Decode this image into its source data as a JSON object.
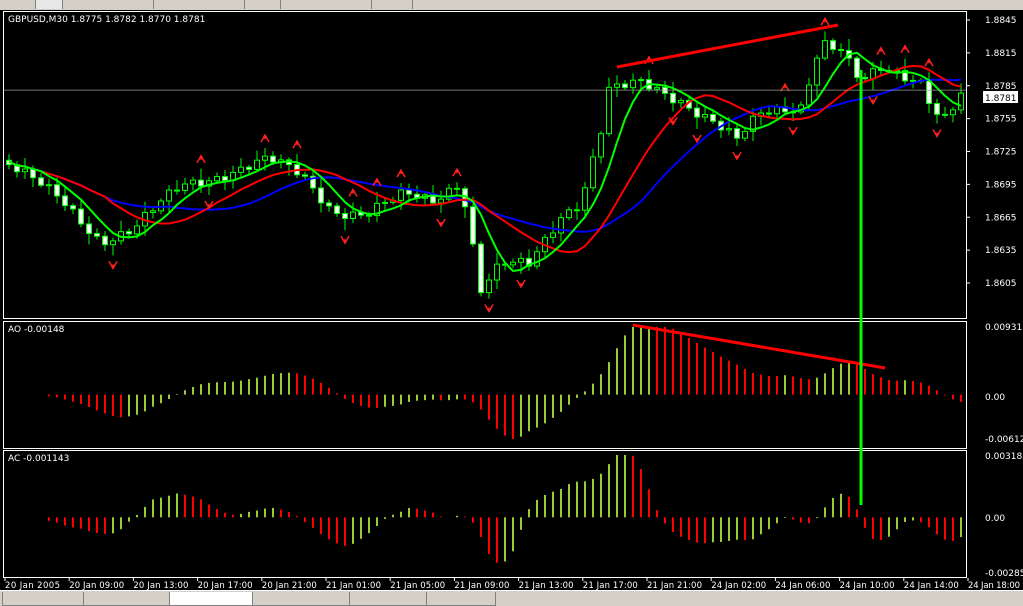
{
  "symbol_header": "GBPUSD,M30  1.8775 1.8782 1.8770 1.8781",
  "current_price": "1.8781",
  "colors": {
    "bull_outline": "#00ff00",
    "ma_fast": "#00ff00",
    "ma_mid": "#ff0000",
    "ma_slow": "#0000ff",
    "fractal": "#ff2020",
    "ao_up": "#9acd32",
    "ao_down": "#ff0000",
    "trendline": "#ff0000",
    "vline": "#00ff00"
  },
  "chart_data": {
    "type": "candlestick",
    "timeframe": "M30",
    "bar_count": 120,
    "price_keypoints": [
      [
        0,
        1.8713
      ],
      [
        6.5,
        1.8681
      ],
      [
        11.5,
        1.8644
      ],
      [
        15.5,
        1.8653
      ],
      [
        21.5,
        1.8694
      ],
      [
        26.5,
        1.8704
      ],
      [
        32.5,
        1.8717
      ],
      [
        36.5,
        1.8704
      ],
      [
        40.5,
        1.8672
      ],
      [
        44.5,
        1.8667
      ],
      [
        49.5,
        1.8685
      ],
      [
        53,
        1.8681
      ],
      [
        56.5,
        1.8699
      ],
      [
        59,
        1.8599
      ],
      [
        61.5,
        1.8621
      ],
      [
        65,
        1.8621
      ],
      [
        69,
        1.8667
      ],
      [
        71.5,
        1.8681
      ],
      [
        74,
        1.8745
      ],
      [
        75,
        1.8781
      ],
      [
        79,
        1.8786
      ],
      [
        84,
        1.8772
      ],
      [
        88,
        1.8754
      ],
      [
        91,
        1.8735
      ],
      [
        94,
        1.8758
      ],
      [
        99,
        1.8767
      ],
      [
        101.5,
        1.8827
      ],
      [
        104,
        1.8818
      ],
      [
        106.5,
        1.8786
      ],
      [
        109,
        1.8799
      ],
      [
        114,
        1.879
      ],
      [
        116.5,
        1.8754
      ],
      [
        119.5,
        1.8781
      ]
    ],
    "price_axis": {
      "ticks": [
        "1.8845",
        "1.8815",
        "1.8785",
        "1.8755",
        "1.8725",
        "1.8695",
        "1.8665",
        "1.8635",
        "1.8605"
      ],
      "range": [
        1.8605,
        1.8845
      ]
    },
    "ao": {
      "label": "AO -0.00148",
      "ticks": [
        "0.00931",
        "0.00",
        "-0.00612"
      ],
      "range": [
        -0.00612,
        0.00931
      ]
    },
    "ac": {
      "label": "AC -0.001143",
      "ticks": [
        "0.003185",
        "0.00",
        "-0.00285"
      ],
      "range": [
        -0.00285,
        0.003185
      ]
    },
    "time_labels": [
      "20 Jan 2005",
      "20 Jan 09:00",
      "20 Jan 13:00",
      "20 Jan 17:00",
      "20 Jan 21:00",
      "21 Jan 01:00",
      "21 Jan 05:00",
      "21 Jan 09:00",
      "21 Jan 13:00",
      "21 Jan 17:00",
      "21 Jan 21:00",
      "24 Jan 02:00",
      "24 Jan 06:00",
      "24 Jan 10:00",
      "24 Jan 14:00",
      "24 Jan 18:00"
    ],
    "moving_average_periods": [
      5,
      13,
      21
    ]
  }
}
